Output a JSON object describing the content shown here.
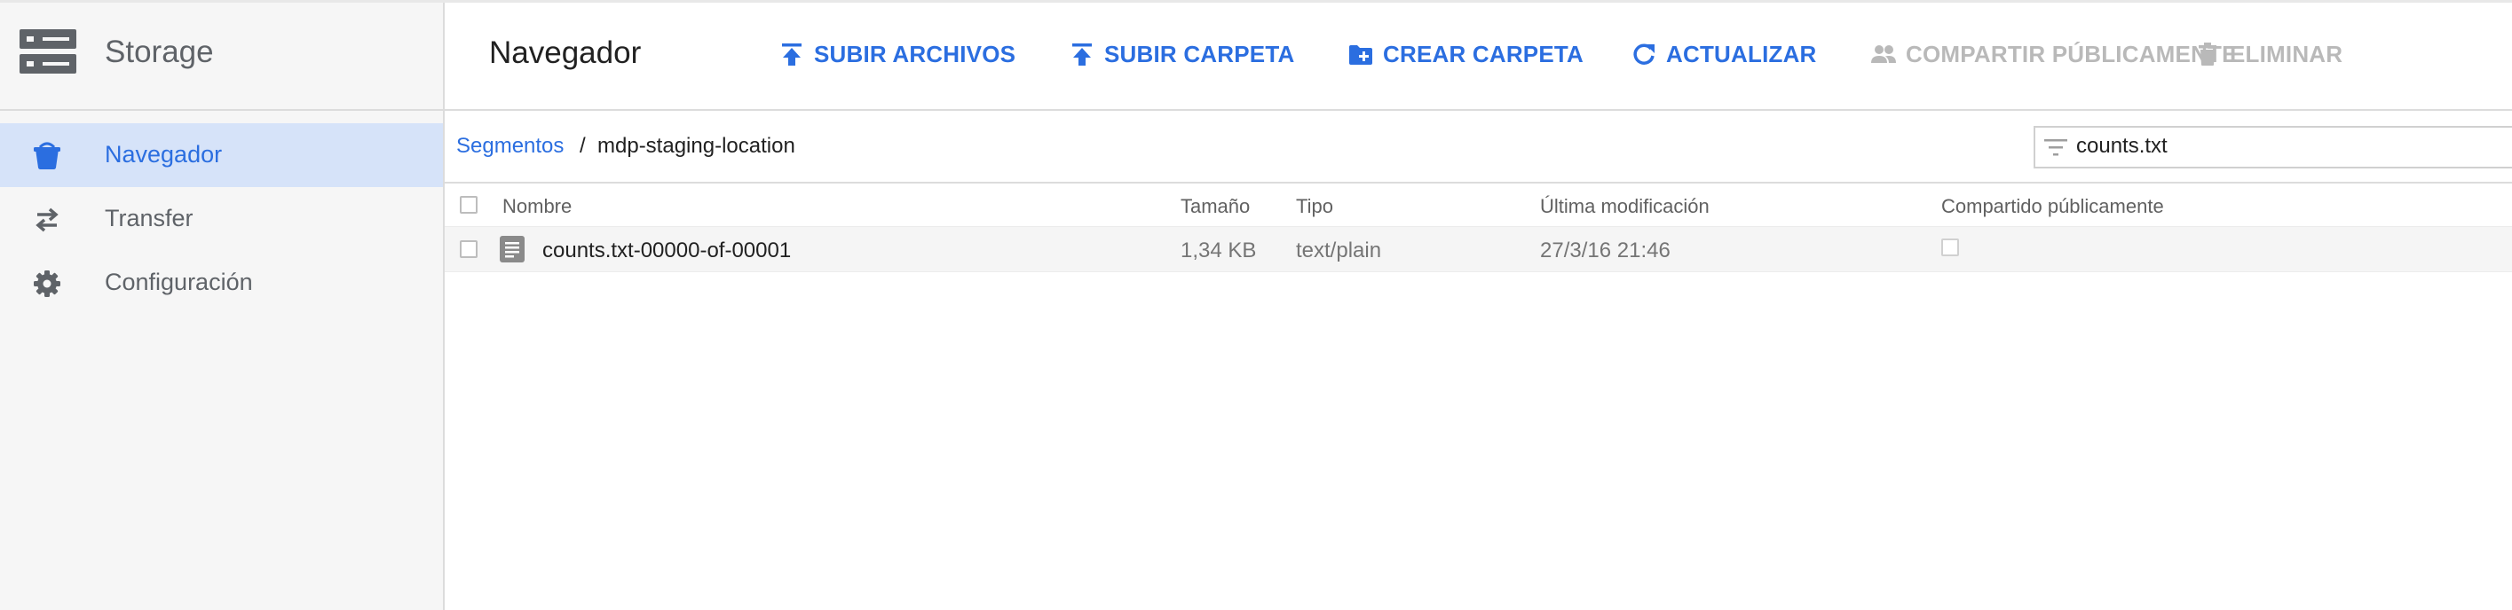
{
  "app": {
    "title": "Storage"
  },
  "sidebar": {
    "items": [
      {
        "label": "Navegador",
        "icon": "bucket-icon",
        "active": true
      },
      {
        "label": "Transfer",
        "icon": "transfer-arrows-icon",
        "active": false
      },
      {
        "label": "Configuración",
        "icon": "gear-icon",
        "active": false
      }
    ]
  },
  "toolbar": {
    "title": "Navegador",
    "buttons": [
      {
        "label": "SUBIR ARCHIVOS",
        "icon": "upload-icon",
        "enabled": true
      },
      {
        "label": "SUBIR CARPETA",
        "icon": "upload-icon",
        "enabled": true
      },
      {
        "label": "CREAR CARPETA",
        "icon": "create-folder-icon",
        "enabled": true
      },
      {
        "label": "ACTUALIZAR",
        "icon": "refresh-icon",
        "enabled": true
      },
      {
        "label": "COMPARTIR PÚBLICAMENTE",
        "icon": "people-icon",
        "enabled": false
      },
      {
        "label": "ELIMINAR",
        "icon": "trash-icon",
        "enabled": false
      }
    ]
  },
  "breadcrumb": {
    "root": "Segmentos",
    "separator": "/",
    "current": "mdp-staging-location"
  },
  "filter": {
    "value": "counts.txt",
    "icon": "filter-icon"
  },
  "table": {
    "columns": [
      "Nombre",
      "Tamaño",
      "Tipo",
      "Última modificación",
      "Compartido públicamente"
    ],
    "rows": [
      {
        "name": "counts.txt-00000-of-00001",
        "size": "1,34 KB",
        "type": "text/plain",
        "modified": "27/3/16 21:46",
        "shared": false,
        "icon": "text-file-icon"
      }
    ]
  },
  "colors": {
    "accent": "#2b6ee0",
    "active_nav_bg": "#d6e3f9",
    "disabled": "#b9b9b9",
    "sidebar_bg": "#f6f6f6"
  }
}
